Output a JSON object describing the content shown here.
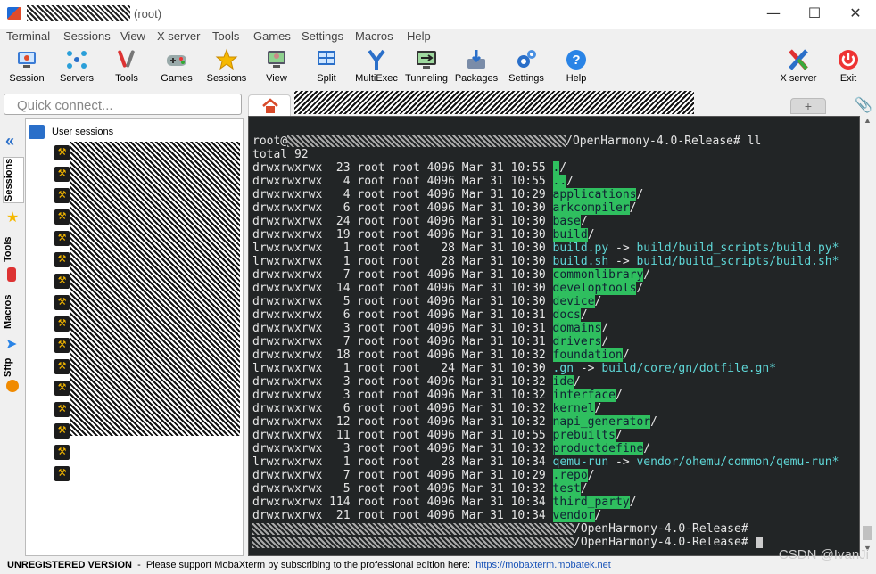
{
  "title": {
    "suffix": "(root)"
  },
  "window_controls": {
    "minimize": "—",
    "maximize": "☐",
    "close": "✕"
  },
  "menu": [
    "Terminal",
    "Sessions",
    "View",
    "X server",
    "Tools",
    "Games",
    "Settings",
    "Macros",
    "Help"
  ],
  "toolbar": [
    {
      "label": "Session",
      "icon": "session-icon"
    },
    {
      "label": "Servers",
      "icon": "servers-icon"
    },
    {
      "label": "Tools",
      "icon": "tools-icon"
    },
    {
      "label": "Games",
      "icon": "games-icon"
    },
    {
      "label": "Sessions",
      "icon": "star-icon"
    },
    {
      "label": "View",
      "icon": "view-icon"
    },
    {
      "label": "Split",
      "icon": "split-icon"
    },
    {
      "label": "MultiExec",
      "icon": "multiexec-icon"
    },
    {
      "label": "Tunneling",
      "icon": "tunneling-icon"
    },
    {
      "label": "Packages",
      "icon": "packages-icon"
    },
    {
      "label": "Settings",
      "icon": "settings-icon"
    },
    {
      "label": "Help",
      "icon": "help-icon"
    },
    {
      "label": "X server",
      "icon": "xserver-icon"
    },
    {
      "label": "Exit",
      "icon": "exit-icon"
    }
  ],
  "quick_connect": {
    "placeholder": "Quick connect..."
  },
  "vertical_tabs": [
    "Sessions",
    "Tools",
    "Macros",
    "Sftp"
  ],
  "sessions_panel": {
    "header": "User sessions",
    "item_count": 16
  },
  "terminal": {
    "prompt_suffix": "/OpenHarmony-4.0-Release#",
    "command": "ll",
    "total": "total 92",
    "entries": [
      {
        "perm": "drwxrwxrwx",
        "links": "23",
        "size": "4096",
        "date": "Mar 31 10:55",
        "name": ".",
        "type": "dir"
      },
      {
        "perm": "drwxrwxrwx",
        "links": "4",
        "size": "4096",
        "date": "Mar 31 10:55",
        "name": "..",
        "type": "dir"
      },
      {
        "perm": "drwxrwxrwx",
        "links": "4",
        "size": "4096",
        "date": "Mar 31 10:29",
        "name": "applications",
        "type": "dir"
      },
      {
        "perm": "drwxrwxrwx",
        "links": "6",
        "size": "4096",
        "date": "Mar 31 10:30",
        "name": "arkcompiler",
        "type": "dir"
      },
      {
        "perm": "drwxrwxrwx",
        "links": "24",
        "size": "4096",
        "date": "Mar 31 10:30",
        "name": "base",
        "type": "dir"
      },
      {
        "perm": "drwxrwxrwx",
        "links": "19",
        "size": "4096",
        "date": "Mar 31 10:30",
        "name": "build",
        "type": "dir"
      },
      {
        "perm": "lrwxrwxrwx",
        "links": "1",
        "size": "28",
        "date": "Mar 31 10:30",
        "name": "build.py",
        "type": "link",
        "target": "build/build_scripts/build.py*"
      },
      {
        "perm": "lrwxrwxrwx",
        "links": "1",
        "size": "28",
        "date": "Mar 31 10:30",
        "name": "build.sh",
        "type": "link",
        "target": "build/build_scripts/build.sh*"
      },
      {
        "perm": "drwxrwxrwx",
        "links": "7",
        "size": "4096",
        "date": "Mar 31 10:30",
        "name": "commonlibrary",
        "type": "dir"
      },
      {
        "perm": "drwxrwxrwx",
        "links": "14",
        "size": "4096",
        "date": "Mar 31 10:30",
        "name": "developtools",
        "type": "dir"
      },
      {
        "perm": "drwxrwxrwx",
        "links": "5",
        "size": "4096",
        "date": "Mar 31 10:30",
        "name": "device",
        "type": "dir"
      },
      {
        "perm": "drwxrwxrwx",
        "links": "6",
        "size": "4096",
        "date": "Mar 31 10:31",
        "name": "docs",
        "type": "dir"
      },
      {
        "perm": "drwxrwxrwx",
        "links": "3",
        "size": "4096",
        "date": "Mar 31 10:31",
        "name": "domains",
        "type": "dir"
      },
      {
        "perm": "drwxrwxrwx",
        "links": "7",
        "size": "4096",
        "date": "Mar 31 10:31",
        "name": "drivers",
        "type": "dir"
      },
      {
        "perm": "drwxrwxrwx",
        "links": "18",
        "size": "4096",
        "date": "Mar 31 10:32",
        "name": "foundation",
        "type": "dir"
      },
      {
        "perm": "lrwxrwxrwx",
        "links": "1",
        "size": "24",
        "date": "Mar 31 10:30",
        "name": ".gn",
        "type": "link",
        "target": "build/core/gn/dotfile.gn*"
      },
      {
        "perm": "drwxrwxrwx",
        "links": "3",
        "size": "4096",
        "date": "Mar 31 10:32",
        "name": "ide",
        "type": "dir"
      },
      {
        "perm": "drwxrwxrwx",
        "links": "3",
        "size": "4096",
        "date": "Mar 31 10:32",
        "name": "interface",
        "type": "dir"
      },
      {
        "perm": "drwxrwxrwx",
        "links": "6",
        "size": "4096",
        "date": "Mar 31 10:32",
        "name": "kernel",
        "type": "dir"
      },
      {
        "perm": "drwxrwxrwx",
        "links": "12",
        "size": "4096",
        "date": "Mar 31 10:32",
        "name": "napi_generator",
        "type": "dir"
      },
      {
        "perm": "drwxrwxrwx",
        "links": "11",
        "size": "4096",
        "date": "Mar 31 10:55",
        "name": "prebuilts",
        "type": "dir"
      },
      {
        "perm": "drwxrwxrwx",
        "links": "3",
        "size": "4096",
        "date": "Mar 31 10:32",
        "name": "productdefine",
        "type": "dir"
      },
      {
        "perm": "lrwxrwxrwx",
        "links": "1",
        "size": "28",
        "date": "Mar 31 10:34",
        "name": "qemu-run",
        "type": "link",
        "target": "vendor/ohemu/common/qemu-run*"
      },
      {
        "perm": "drwxrwxrwx",
        "links": "7",
        "size": "4096",
        "date": "Mar 31 10:29",
        "name": ".repo",
        "type": "dir"
      },
      {
        "perm": "drwxrwxrwx",
        "links": "5",
        "size": "4096",
        "date": "Mar 31 10:32",
        "name": "test",
        "type": "dir"
      },
      {
        "perm": "drwxrwxrwx",
        "links": "114",
        "size": "4096",
        "date": "Mar 31 10:34",
        "name": "third_party",
        "type": "dir"
      },
      {
        "perm": "drwxrwxrwx",
        "links": "21",
        "size": "4096",
        "date": "Mar 31 10:34",
        "name": "vendor",
        "type": "dir"
      }
    ]
  },
  "status": {
    "label": "UNREGISTERED VERSION",
    "message": "  -  Please support MobaXterm by subscribing to the professional edition here:  ",
    "link": "https://mobaxterm.mobatek.net"
  },
  "watermark": "CSDN @IvanJi",
  "colors": {
    "terminal_bg": "#222526",
    "dir_highlight": "#2fbf5f",
    "link": "#5fd7d7"
  }
}
